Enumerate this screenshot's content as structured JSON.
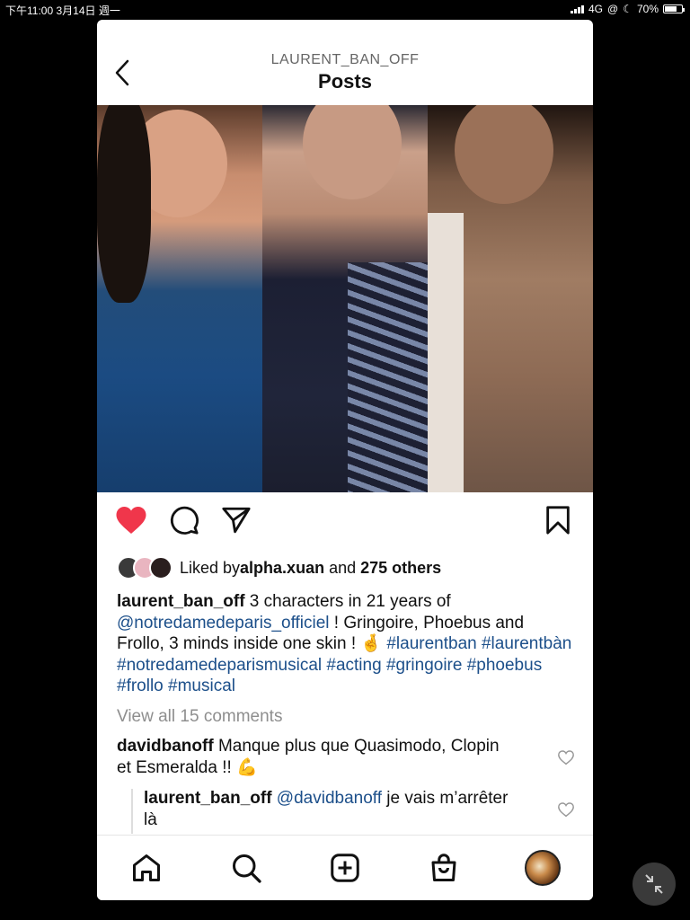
{
  "status_bar": {
    "left": "下午11:00   3月14日 週一",
    "network": "4G",
    "battery": "70%",
    "battery_level": 0.7
  },
  "header": {
    "username": "LAURENT_BAN_OFF",
    "title": "Posts"
  },
  "post": {
    "liked_by_prefix": "Liked by ",
    "liked_by_user": "alpha.xuan",
    "liked_by_mid": " and ",
    "liked_by_others": "275 others",
    "caption": {
      "author": "laurent_ban_off",
      "text1": " 3 characters in 21 years of ",
      "mention": "@notredamedeparis_officiel",
      "text2": " ! Gringoire, Phoebus and Frollo, 3 minds inside one skin ! 🤞 ",
      "hashtags": "#laurentban #laurentbàn #notredamedeparismusical #acting #gringoire #phoebus #frollo #musical"
    },
    "view_all": "View all 15 comments",
    "comments": [
      {
        "author": "davidbanoff",
        "text": " Manque plus que Quasimodo, Clopin et Esmeralda !! 💪"
      },
      {
        "author": "laurent_ban_off",
        "mention": " @davidbanoff",
        "text": " je vais m’arrêter là"
      }
    ]
  },
  "colors": {
    "like_red": "#f0364b",
    "link_blue": "#1c4f8a"
  },
  "icons": [
    "back-chevron-icon",
    "heart-icon",
    "comment-icon",
    "share-icon",
    "bookmark-icon",
    "home-icon",
    "search-icon",
    "add-icon",
    "shop-icon",
    "profile-avatar",
    "collapse-icon"
  ]
}
